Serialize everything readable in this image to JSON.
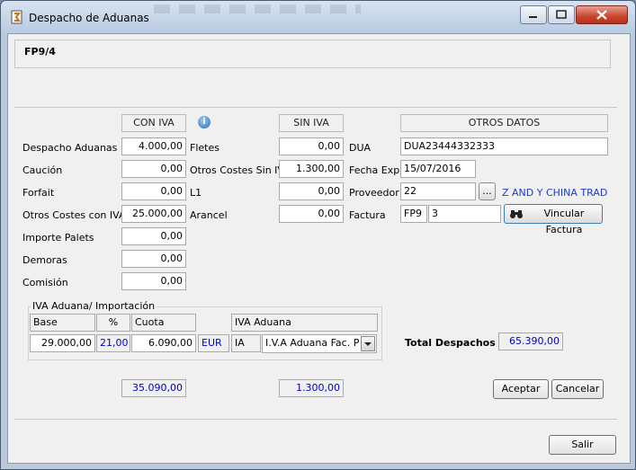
{
  "window": {
    "title": "Despacho de Aduanas"
  },
  "header": {
    "code": "FP9/4"
  },
  "columns": {
    "con_iva": "CON IVA",
    "sin_iva": "SIN IVA",
    "otros": "OTROS DATOS"
  },
  "con_iva": {
    "despacho_label": "Despacho Aduanas",
    "despacho_value": "4.000,00",
    "caucion_label": "Caución",
    "caucion_value": "0,00",
    "forfait_label": "Forfait",
    "forfait_value": "0,00",
    "otros_label": "Otros Costes con IVA",
    "otros_value": "25.000,00",
    "palets_label": "Importe Palets",
    "palets_value": "0,00",
    "demoras_label": "Demoras",
    "demoras_value": "0,00",
    "comision_label": "Comisión",
    "comision_value": "0,00",
    "total": "35.090,00"
  },
  "sin_iva": {
    "fletes_label": "Fletes",
    "fletes_value": "0,00",
    "otros_label": "Otros Costes Sin IVA",
    "otros_value": "1.300,00",
    "l1_label": "L1",
    "l1_value": "0,00",
    "arancel_label": "Arancel",
    "arancel_value": "0,00",
    "total": "1.300,00"
  },
  "otros": {
    "dua_label": "DUA",
    "dua_value": "DUA23444332333",
    "fecha_label": "Fecha Exp",
    "fecha_value": "15/07/2016",
    "proveedor_label": "Proveedor",
    "proveedor_value": "22",
    "proveedor_btn": "...",
    "proveedor_name": "Z AND Y CHINA TRAD",
    "factura_label": "Factura",
    "factura_serie": "FP9",
    "factura_num": "3",
    "vincular_btn": "Vincular Factura"
  },
  "iva": {
    "group_title": "IVA Aduana/ Importación",
    "base_label": "Base",
    "base_value": "29.000,00",
    "pct_label": "%",
    "pct_value": "21,00",
    "cuota_label": "Cuota",
    "cuota_value": "6.090,00",
    "currency": "EUR",
    "aduana_label": "IVA Aduana",
    "aduana_code": "IA",
    "aduana_select": "I.V.A Aduana Fac. Pr"
  },
  "totals": {
    "label": "Total Despachos",
    "value": "65.390,00"
  },
  "buttons": {
    "aceptar": "Aceptar",
    "cancelar": "Cancelar",
    "salir": "Salir"
  },
  "colors": {
    "accent_value": "#0000c8",
    "link": "#1a3bd1",
    "close_button": "#c8452e"
  }
}
